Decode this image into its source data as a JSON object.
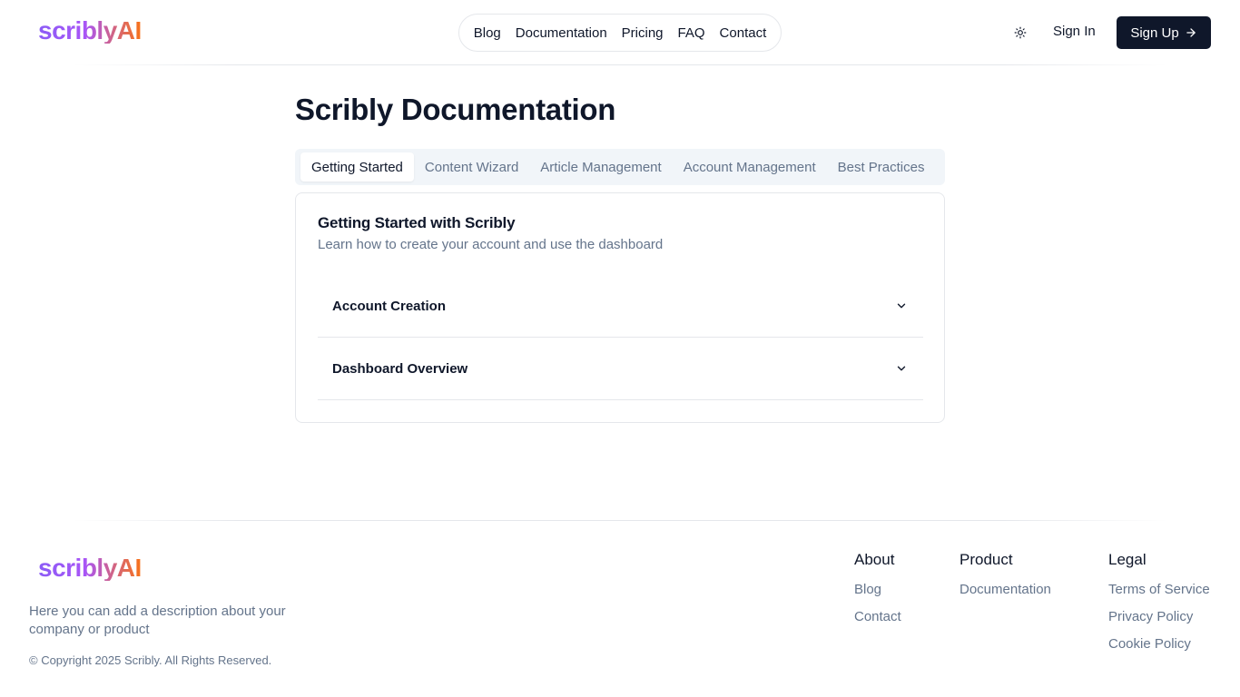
{
  "brand": {
    "name": "scriblyAI"
  },
  "header": {
    "nav": [
      {
        "label": "Blog"
      },
      {
        "label": "Documentation"
      },
      {
        "label": "Pricing"
      },
      {
        "label": "FAQ"
      },
      {
        "label": "Contact"
      }
    ],
    "theme_icon": "sun-icon",
    "sign_in": "Sign In",
    "sign_up": "Sign Up",
    "sign_up_icon": "arrow-right-icon"
  },
  "main": {
    "title": "Scribly Documentation",
    "tabs": [
      {
        "label": "Getting Started",
        "active": true
      },
      {
        "label": "Content Wizard",
        "active": false
      },
      {
        "label": "Article Management",
        "active": false
      },
      {
        "label": "Account Management",
        "active": false
      },
      {
        "label": "Best Practices",
        "active": false
      }
    ],
    "card": {
      "title": "Getting Started with Scribly",
      "description": "Learn how to create your account and use the dashboard",
      "accordion": [
        {
          "label": "Account Creation",
          "icon": "chevron-down-icon"
        },
        {
          "label": "Dashboard Overview",
          "icon": "chevron-down-icon"
        }
      ]
    }
  },
  "footer": {
    "description": "Here you can add a description about your company or product",
    "copyright": "© Copyright 2025 Scribly. All Rights Reserved.",
    "columns": [
      {
        "heading": "About",
        "links": [
          "Blog",
          "Contact"
        ]
      },
      {
        "heading": "Product",
        "links": [
          "Documentation"
        ]
      },
      {
        "heading": "Legal",
        "links": [
          "Terms of Service",
          "Privacy Policy",
          "Cookie Policy"
        ]
      }
    ]
  },
  "colors": {
    "primary": "#0f172a",
    "muted": "#64748b",
    "border": "#e5e7eb",
    "brand_gradient_start": "#8b5cf6",
    "brand_gradient_end": "#f97316"
  }
}
